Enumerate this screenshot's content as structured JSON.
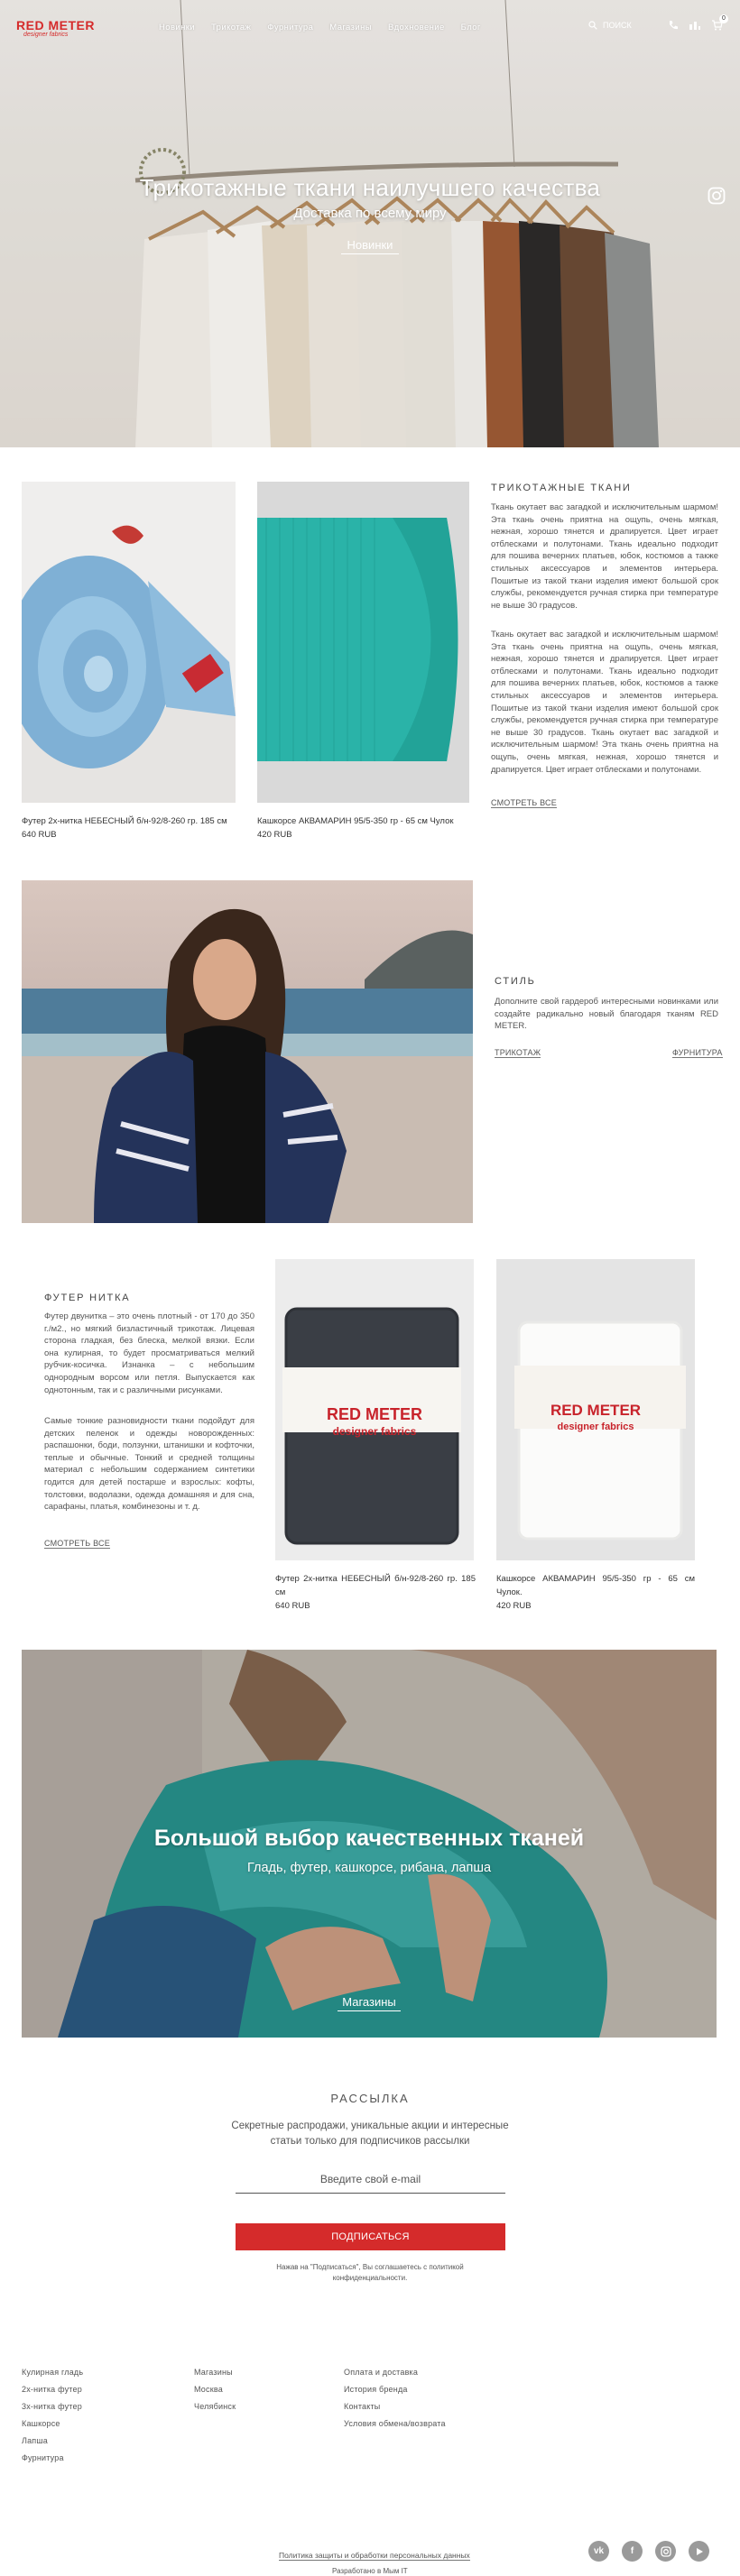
{
  "header": {
    "logo_main": "RED METER",
    "logo_sub": "designer fabrics",
    "nav": [
      "Новинки",
      "Трикотаж",
      "Фурнитура",
      "Магазины",
      "Вдохновение",
      "Блог"
    ],
    "search_placeholder": "ПОИСК",
    "cart_count": "0"
  },
  "hero": {
    "title": "Трикотажные ткани наилучшего качества",
    "subtitle": "Доставка по всему миру",
    "button": "Новинки"
  },
  "section1": {
    "product1": {
      "name": "Футер 2х-нитка НЕБЕСНЫЙ б/н-92/8-260 гр. 185 см",
      "price": "640 RUB"
    },
    "product2": {
      "name": "Кашкорсе АКВАМАРИН 95/5-350 гр - 65 см Чулок",
      "price": "420 RUB"
    },
    "heading": "ТРИКОТАЖНЫЕ ТКАНИ",
    "para1": "Ткань окутает вас загадкой и исключительным шармом! Эта ткань очень приятна на ощупь, очень мягкая, нежная, хорошо тянется и драпируется. Цвет играет отблесками и полутонами. Ткань идеально подходит для пошива вечерних платьев, юбок, костюмов а также стильных аксессуаров и элементов интерьера. Пошитые из такой ткани изделия имеют большой срок службы, рекомендуется ручная стирка при температуре не выше 30 градусов.",
    "para2": "Ткань окутает вас загадкой и исключительным шармом! Эта ткань очень приятна на ощупь, очень мягкая, нежная, хорошо тянется и драпируется. Цвет играет отблесками и полутонами. Ткань идеально подходит для пошива вечерних платьев, юбок, костюмов а также стильных аксессуаров и элементов интерьера. Пошитые из такой ткани изделия имеют большой срок службы, рекомендуется ручная стирка при температуре не выше 30 градусов. Ткань окутает вас загадкой и исключительным шармом! Эта ткань очень приятна на ощупь, очень мягкая, нежная, хорошо тянется и драпируется. Цвет играет отблесками и полутонами.",
    "link": "СМОТРЕТЬ ВСЕ"
  },
  "section2": {
    "heading": "СТИЛЬ",
    "text": "Дополните свой гардероб интересными новинками или создайте радикально новый благодаря тканям RED METER.",
    "link1": "ТРИКОТАЖ",
    "link2": "ФУРНИТУРА"
  },
  "section3": {
    "heading": "ФУТЕР НИТКА",
    "para1": "Футер двунитка – это очень плотный - от 170 до 350 г./м2., но мягкий бизластичный трикотаж. Лицевая сторона гладкая, без блеска, мелкой вязки. Если она кулирная, то будет просматриваться мелкий рубчик-косичка. Изнанка – с небольшим однородным ворсом или петля. Выпускается как однотонным, так и с различными рисунками.",
    "para2": "Самые тонкие разновидности ткани подойдут для детских пеленок и одежды новорожденных: распашонки, боди, ползунки, штанишки и кофточки, теплые и обычные. Тонкий и средней толщины материал с небольшим содержанием синтетики годится для детей постарше и взрослых: кофты, толстовки, водолазки, одежда домашняя и для сна, сарафаны, платья, комбинезоны и т. д.",
    "link": "СМОТРЕТЬ ВСЕ",
    "product1": {
      "name": "Футер 2х-нитка НЕБЕСНЫЙ б/н-92/8-260 гр. 185 см",
      "price": "640 RUB",
      "label_main": "RED METER",
      "label_sub": "designer fabrics"
    },
    "product2": {
      "name": "Кашкорсе АКВАМАРИН 95/5-350 гр - 65 см Чулок.",
      "price": "420 RUB",
      "label_main": "RED METER",
      "label_sub": "designer fabrics"
    }
  },
  "banner": {
    "title": "Большой выбор качественных тканей",
    "subtitle": "Гладь, футер, кашкорсе, рибана, лапша",
    "button": "Магазины"
  },
  "newsletter": {
    "heading": "РАССЫЛКА",
    "text": "Секретные распродажи, уникальные акции и интересные статьи только для подписчиков рассылки",
    "placeholder": "Введите свой e-mail",
    "button": "ПОДПИСАТЬСЯ",
    "note": "Нажав на \"Подписаться\", Вы соглашаетесь с политикой конфиденциальности."
  },
  "footer": {
    "col1": [
      "Кулирная гладь",
      "2х-нитка футер",
      "3х-нитка футер",
      "Кашкорсе",
      "Лапша",
      "Фурнитура"
    ],
    "col2": [
      "Магазины",
      "Москва",
      "Челябинск"
    ],
    "col3": [
      "Оплата и доставка",
      "История бренда",
      "Контакты",
      "Условия обмена/возврата"
    ],
    "privacy": "Политика защиты и обработки персональных данных",
    "dev": "Разработано в Мым IT",
    "socials": [
      "vk-icon",
      "facebook-icon",
      "instagram-icon",
      "youtube-icon"
    ]
  },
  "colors": {
    "accent": "#d52b2b",
    "teal": "#2ab3a8",
    "text": "#333333"
  }
}
